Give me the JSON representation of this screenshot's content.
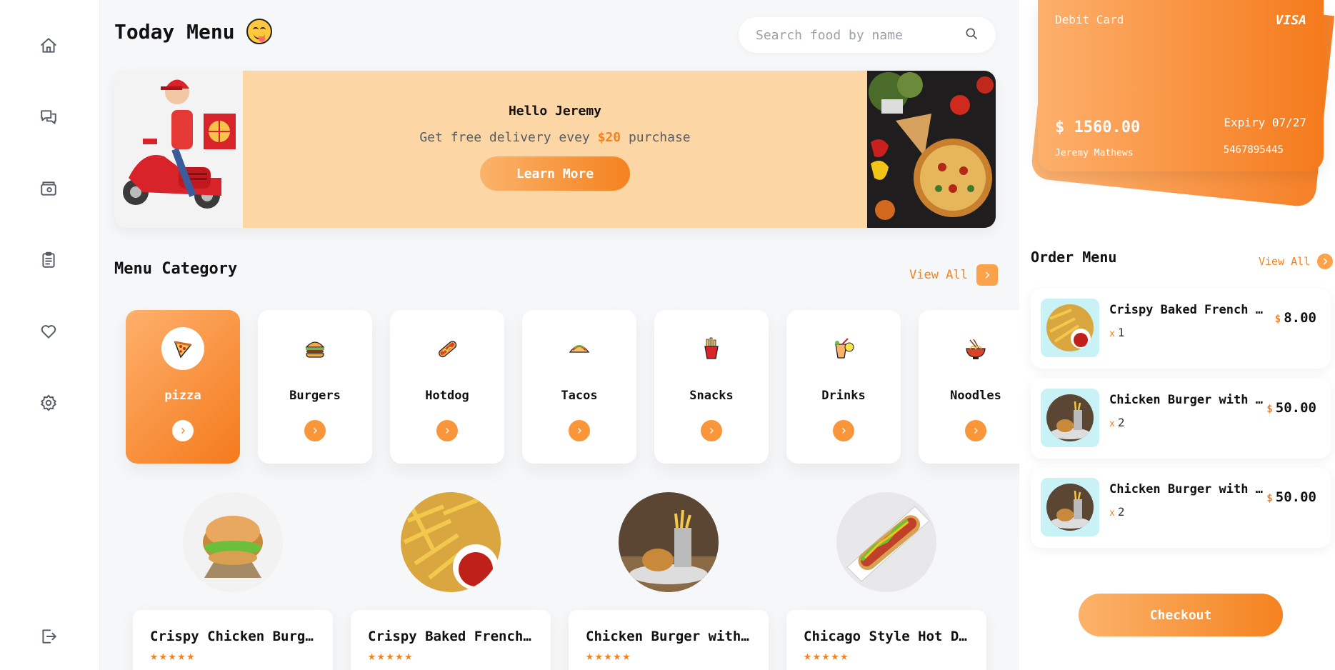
{
  "header": {
    "title": "Today Menu"
  },
  "search": {
    "placeholder": "Search food by name"
  },
  "banner": {
    "greeting": "Hello Jeremy",
    "promo_prefix": "Get free delivery evey ",
    "promo_amount": "$20",
    "promo_suffix": " purchase",
    "button": "Learn More"
  },
  "categories": {
    "title": "Menu Category",
    "view_all": "View All",
    "items": [
      {
        "label": "pizza",
        "icon": "pizza-icon",
        "active": true
      },
      {
        "label": "Burgers",
        "icon": "burger-icon"
      },
      {
        "label": "Hotdog",
        "icon": "hotdog-icon"
      },
      {
        "label": "Tacos",
        "icon": "taco-icon"
      },
      {
        "label": "Snacks",
        "icon": "fries-icon"
      },
      {
        "label": "Drinks",
        "icon": "drink-icon"
      },
      {
        "label": "Noodles",
        "icon": "noodles-icon"
      }
    ]
  },
  "foods": [
    {
      "name": "Crispy Chicken Burger",
      "stars": "★★★★★"
    },
    {
      "name": "Crispy Baked French Fries",
      "stars": "★★★★★"
    },
    {
      "name": "Chicken Burger with Fries",
      "stars": "★★★★★"
    },
    {
      "name": "Chicago Style Hot Dog",
      "stars": "★★★★★"
    }
  ],
  "card": {
    "label": "Debit Card",
    "brand": "VISA",
    "balance": "$ 1560.00",
    "expiry": "Expiry 07/27",
    "holder": "Jeremy Mathews",
    "number": "5467895445"
  },
  "orders": {
    "title": "Order Menu",
    "view_all": "View All",
    "items": [
      {
        "name": "Crispy Baked French Fries",
        "x": "x",
        "qty": "1",
        "currency": "$",
        "price": "8.00"
      },
      {
        "name": "Chicken Burger with Fries",
        "x": "x",
        "qty": "2",
        "currency": "$",
        "price": "50.00"
      },
      {
        "name": "Chicken Burger with Fries",
        "x": "x",
        "qty": "2",
        "currency": "$",
        "price": "50.00"
      }
    ]
  },
  "checkout": {
    "label": "Checkout"
  },
  "colors": {
    "accent": "#f5821f",
    "accent_light": "#fdb06c",
    "banner_bg": "#fdd6a5"
  }
}
